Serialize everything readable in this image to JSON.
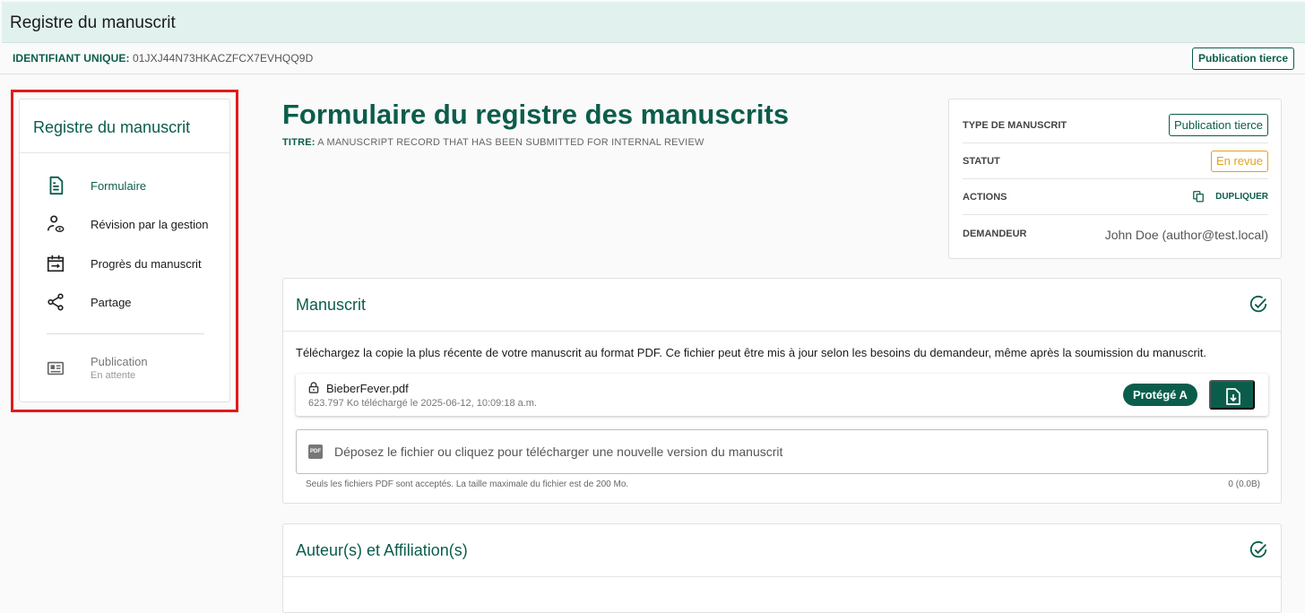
{
  "header": {
    "title": "Registre du manuscrit"
  },
  "idbar": {
    "id_label": "IDENTIFIANT UNIQUE:",
    "id_value": "01JXJ44N73HKACZFCX7EVHQQ9D",
    "type_button": "Publication tierce"
  },
  "sidebar": {
    "title": "Registre du manuscrit",
    "items": [
      {
        "label": "Formulaire",
        "icon": "document-icon",
        "active": true
      },
      {
        "label": "Révision par la gestion",
        "icon": "user-review-icon",
        "active": false
      },
      {
        "label": "Progrès du manuscrit",
        "icon": "calendar-progress-icon",
        "active": false
      },
      {
        "label": "Partage",
        "icon": "share-icon",
        "active": false
      }
    ],
    "publication": {
      "label": "Publication",
      "status": "En attente",
      "icon": "newspaper-icon"
    }
  },
  "main": {
    "title": "Formulaire du registre des manuscrits",
    "subtitle_label": "TITRE:",
    "subtitle_value": "A MANUSCRIPT RECORD THAT HAS BEEN SUBMITTED FOR INTERNAL REVIEW"
  },
  "info": {
    "type_label": "TYPE DE MANUSCRIT",
    "type_value": "Publication tierce",
    "status_label": "STATUT",
    "status_value": "En revue",
    "actions_label": "ACTIONS",
    "duplicate_label": "DUPLIQUER",
    "requester_label": "DEMANDEUR",
    "requester_value": "John Doe (author@test.local)"
  },
  "manuscript": {
    "title": "Manuscrit",
    "description": "Téléchargez la copie la plus récente de votre manuscrit au format PDF. Ce fichier peut être mis à jour selon les besoins du demandeur, même après la soumission du manuscrit.",
    "file_name": "BieberFever.pdf",
    "file_meta": "623.797 Ko téléchargé le 2025-06-12, 10:09:18 a.m.",
    "protection": "Protégé A",
    "drop_text": "Déposez le fichier ou cliquez pour télécharger une nouvelle version du manuscrit",
    "pdf_icon_text": "PDF",
    "hint": "Seuls les fichiers PDF sont acceptés. La taille maximale du fichier est de 200 Mo.",
    "size": "0 (0.0B)"
  },
  "authors": {
    "title": "Auteur(s) et Affiliation(s)"
  },
  "colors": {
    "brand": "#0b5d4b",
    "header_bg": "#e1f2ee",
    "status_warning": "#e4a11b",
    "highlight": "#e01b1b"
  }
}
